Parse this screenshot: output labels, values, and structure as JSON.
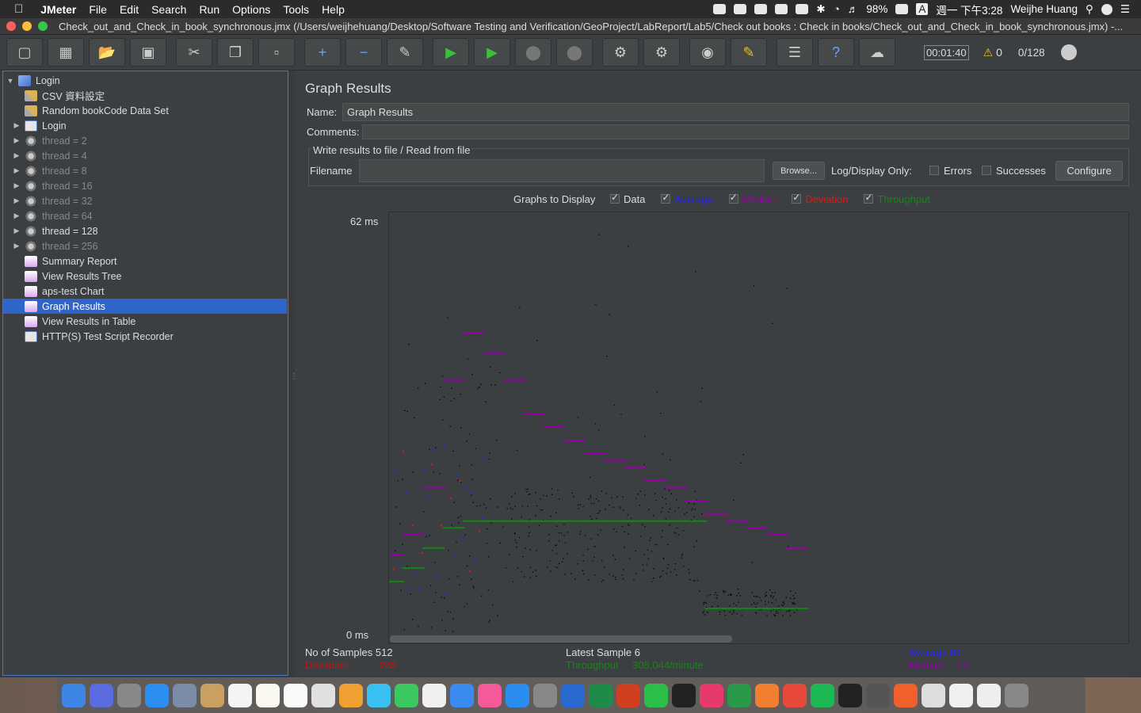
{
  "menubar": {
    "app": "JMeter",
    "menus": [
      "File",
      "Edit",
      "Search",
      "Run",
      "Options",
      "Tools",
      "Help"
    ],
    "battery": "98%",
    "input": "A",
    "datetime": "週一 下午3:28",
    "user": "Weijhe Huang"
  },
  "window": {
    "title": "Check_out_and_Check_in_book_synchronous.jmx (/Users/weijhehuang/Desktop/Software Testing and Verification/GeoProject/LabReport/Lab5/Check out books : Check in books/Check_out_and_Check_in_book_synchronous.jmx) -..."
  },
  "toolbar": {
    "timer": "00:01:40",
    "warnings": "0",
    "threads": "0/128"
  },
  "tree": {
    "items": [
      {
        "label": "Login",
        "icon": "flask-icon",
        "level": 0,
        "toggle": "▼",
        "disabled": false
      },
      {
        "label": "CSV 資料設定",
        "icon": "tools-icon",
        "level": 1,
        "toggle": "",
        "disabled": false
      },
      {
        "label": "Random bookCode Data Set",
        "icon": "tools-icon",
        "level": 1,
        "toggle": "",
        "disabled": false
      },
      {
        "label": "Login",
        "icon": "controller-icon",
        "level": 1,
        "toggle": "▶",
        "disabled": false
      },
      {
        "label": "thread = 2",
        "icon": "gear-icon",
        "level": 1,
        "toggle": "▶",
        "disabled": true
      },
      {
        "label": "thread = 4",
        "icon": "gear-icon",
        "level": 1,
        "toggle": "▶",
        "disabled": true
      },
      {
        "label": "thread = 8",
        "icon": "gear-icon",
        "level": 1,
        "toggle": "▶",
        "disabled": true
      },
      {
        "label": "thread = 16",
        "icon": "gear-icon",
        "level": 1,
        "toggle": "▶",
        "disabled": true
      },
      {
        "label": "thread = 32",
        "icon": "gear-icon",
        "level": 1,
        "toggle": "▶",
        "disabled": true
      },
      {
        "label": "thread = 64",
        "icon": "gear-icon",
        "level": 1,
        "toggle": "▶",
        "disabled": true
      },
      {
        "label": "thread = 128",
        "icon": "gear-icon",
        "level": 1,
        "toggle": "▶",
        "disabled": false
      },
      {
        "label": "thread = 256",
        "icon": "gear-icon",
        "level": 1,
        "toggle": "▶",
        "disabled": true
      },
      {
        "label": "Summary Report",
        "icon": "chart-icon",
        "level": 1,
        "toggle": "",
        "disabled": false
      },
      {
        "label": "View Results Tree",
        "icon": "chart-icon",
        "level": 1,
        "toggle": "",
        "disabled": false
      },
      {
        "label": "aps-test Chart",
        "icon": "chart-icon",
        "level": 1,
        "toggle": "",
        "disabled": false
      },
      {
        "label": "Graph Results",
        "icon": "chart-icon",
        "level": 1,
        "toggle": "",
        "disabled": false,
        "selected": true
      },
      {
        "label": "View Results in Table",
        "icon": "chart-icon",
        "level": 1,
        "toggle": "",
        "disabled": false
      },
      {
        "label": "HTTP(S) Test Script Recorder",
        "icon": "controller-icon",
        "level": 1,
        "toggle": "",
        "disabled": false
      }
    ]
  },
  "panel": {
    "title": "Graph Results",
    "name_label": "Name:",
    "name_value": "Graph Results",
    "comments_label": "Comments:",
    "file_legend": "Write results to file / Read from file",
    "filename_label": "Filename",
    "browse": "Browse...",
    "logdisplay": "Log/Display Only:",
    "errors": "Errors",
    "successes": "Successes",
    "configure": "Configure",
    "graphs_to_display": "Graphs to Display",
    "toggles": [
      {
        "label": "Data",
        "color": "#dddddd"
      },
      {
        "label": "Average",
        "color": "#2222ff"
      },
      {
        "label": "Median",
        "color": "#9900aa"
      },
      {
        "label": "Deviation",
        "color": "#ee1111"
      },
      {
        "label": "Throughput",
        "color": "#118811"
      }
    ],
    "y_max": "62  ms",
    "y_min": "0  ms"
  },
  "stats": {
    "samples_label": "No of Samples",
    "samples": "512",
    "latest_label": "Latest Sample",
    "latest": "6",
    "average_label": "Average",
    "average": "84",
    "deviation_label": "Deviation",
    "deviation": "285",
    "throughput_label": "Throughput",
    "throughput": "308.044/minute",
    "median_label": "Median",
    "median": "13"
  },
  "colors": {
    "average": "#2222ff",
    "median": "#9900aa",
    "deviation": "#ee1111",
    "throughput": "#118811",
    "selection": "#2f65ca"
  },
  "chart_data": {
    "type": "scatter",
    "ylim": [
      0,
      62
    ],
    "series": [
      {
        "name": "Median",
        "values": [
          12,
          15,
          22,
          38,
          45,
          42,
          38,
          33,
          31,
          29,
          27,
          26,
          25,
          23,
          22,
          20,
          18,
          17,
          16,
          15,
          13
        ]
      },
      {
        "name": "Throughput",
        "values": [
          8,
          10,
          13,
          16,
          17,
          17,
          17,
          17,
          17,
          17,
          17,
          17,
          17,
          17,
          17,
          17,
          4,
          4,
          4,
          4,
          4
        ]
      }
    ]
  }
}
